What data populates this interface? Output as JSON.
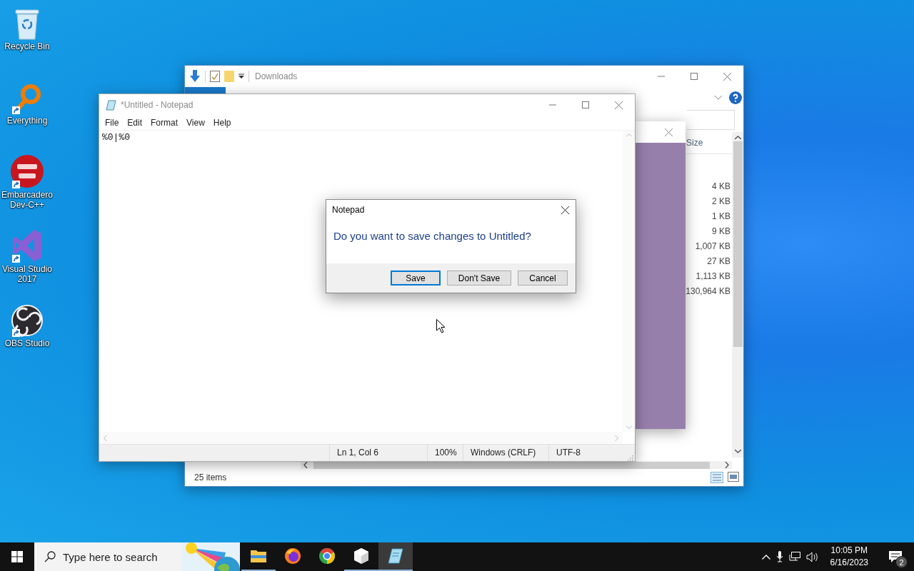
{
  "desktop_icons": [
    {
      "label": "Recycle Bin",
      "shortcut": false
    },
    {
      "label": "Everything",
      "shortcut": true
    },
    {
      "label": "Embarcadero Dev-C++",
      "shortcut": true
    },
    {
      "label": "Visual Studio 2017",
      "shortcut": true
    },
    {
      "label": "OBS Studio",
      "shortcut": true
    }
  ],
  "explorer": {
    "title": "Downloads",
    "size_header": "Size",
    "sizes": [
      "4 KB",
      "2 KB",
      "1 KB",
      "9 KB",
      "1,007 KB",
      "27 KB",
      "1,113 KB",
      "130,964 KB"
    ],
    "status": "25 items"
  },
  "notepad": {
    "title": "*Untitled - Notepad",
    "menu": [
      "File",
      "Edit",
      "Format",
      "View",
      "Help"
    ],
    "text": "%0|%0",
    "status": [
      "Ln 1, Col 6",
      "100%",
      "Windows (CRLF)",
      "UTF-8"
    ]
  },
  "dialog": {
    "title": "Notepad",
    "message": "Do you want to save changes to Untitled?",
    "buttons": [
      {
        "label": "Save",
        "default": true
      },
      {
        "label": "Don't Save",
        "default": false
      },
      {
        "label": "Cancel",
        "default": false
      }
    ]
  },
  "taskbar": {
    "search": {
      "placeholder": "Type here to search"
    },
    "apps": [
      {
        "running": true,
        "selected": false
      },
      {
        "running": false,
        "selected": false
      },
      {
        "running": false,
        "selected": false
      },
      {
        "running": true,
        "selected": false
      },
      {
        "running": true,
        "selected": true
      }
    ],
    "time": "10:05 PM",
    "date": "6/16/2023",
    "notifications": "2"
  }
}
